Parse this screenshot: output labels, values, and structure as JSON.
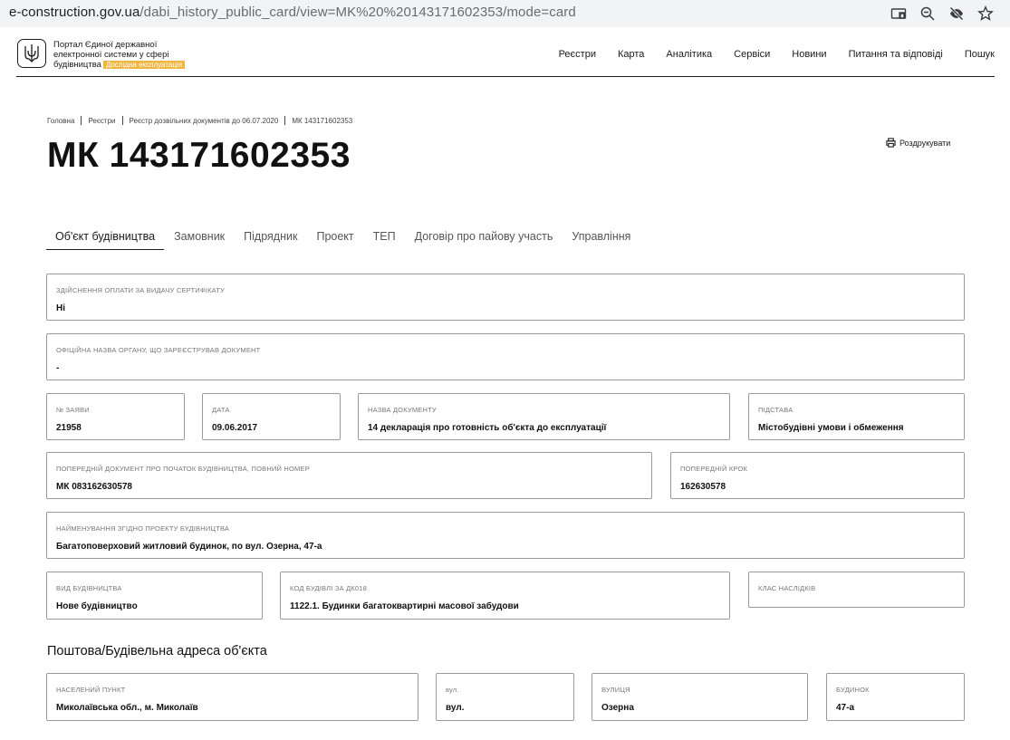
{
  "browser": {
    "url_host": "e-construction.gov.ua",
    "url_path": "/dabi_history_public_card/view=MK%20%20143171602353/mode=card"
  },
  "header": {
    "brand_line1": "Портал Єдиної державної",
    "brand_line2": "електронної системи у сфері",
    "brand_line3": "будівництва",
    "badge": "Дослідна експлуатація",
    "nav": [
      "Реєстри",
      "Карта",
      "Аналітика",
      "Сервіси",
      "Новини",
      "Питання та відповіді",
      "Пошук"
    ]
  },
  "breadcrumbs": [
    "Головна",
    "Реєстри",
    "Реєстр дозвільних документів до 06.07.2020",
    "МК 143171602353"
  ],
  "page_title": "МК 143171602353",
  "print_label": "Роздрукувати",
  "tabs": [
    "Об'єкт будівництва",
    "Замовник",
    "Підрядник",
    "Проект",
    "ТЕП",
    "Договір про пайову участь",
    "Управління"
  ],
  "fields": {
    "payment": {
      "label": "Здійснення оплати за видачу сертифікату",
      "value": "Ні"
    },
    "authority": {
      "label": "Офіційна назва органу, що зареєстрував документ",
      "value": "-"
    },
    "app_no": {
      "label": "№ заяви",
      "value": "21958"
    },
    "date": {
      "label": "Дата",
      "value": "09.06.2017"
    },
    "doc_name": {
      "label": "Назва документу",
      "value": "14 декларація про готовність об'єкта до експлуатації"
    },
    "basis": {
      "label": "Підстава",
      "value": "Містобудівні умови і обмеження"
    },
    "prev_doc": {
      "label": "Попередній документ про початок будівництва, повний номер",
      "value": "МК 083162630578"
    },
    "prev_step": {
      "label": "Попередній крок",
      "value": "162630578"
    },
    "project_name": {
      "label": "Найменування згідно проекту будівництва",
      "value": "Багатоповерховий житловий будинок, по вул. Озерна, 47-а"
    },
    "build_type": {
      "label": "Вид будівництва",
      "value": "Нове будівництво"
    },
    "building_code": {
      "label": "Код будівлі за ДК018",
      "value": "1122.1. Будинки багатоквартирні масової забудови"
    },
    "consequence": {
      "label": "Клас наслідків",
      "value": ""
    }
  },
  "address": {
    "title": "Поштова/Будівельна адреса об'єкта",
    "settlement": {
      "label": "Населений пункт",
      "value": "Миколаївська обл., м. Миколаїв"
    },
    "street_type": {
      "label": "вул.",
      "value": "вул."
    },
    "street": {
      "label": "Вулиця",
      "value": "Озерна"
    },
    "house": {
      "label": "Будинок",
      "value": "47-а"
    }
  }
}
